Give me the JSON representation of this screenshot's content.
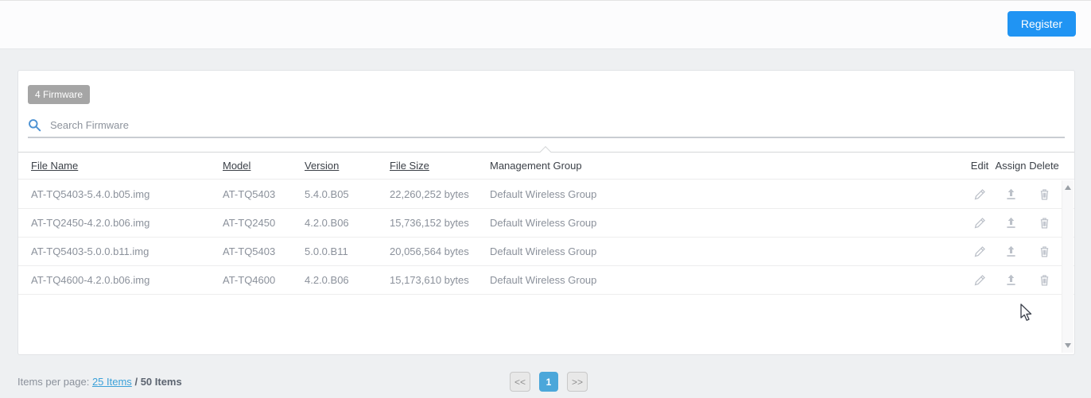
{
  "topbar": {
    "register_label": "Register"
  },
  "panel": {
    "badge_label": "4 Firmware",
    "search_placeholder": "Search Firmware",
    "search_value": ""
  },
  "table": {
    "headers": {
      "file_name": "File Name",
      "model": "Model",
      "version": "Version",
      "file_size": "File Size",
      "management_group": "Management Group",
      "edit": "Edit",
      "assign": "Assign",
      "delete": "Delete"
    },
    "rows": [
      {
        "file_name": "AT-TQ5403-5.4.0.b05.img",
        "model": "AT-TQ5403",
        "version": "5.4.0.B05",
        "file_size": "22,260,252 bytes",
        "management_group": "Default Wireless Group"
      },
      {
        "file_name": "AT-TQ2450-4.2.0.b06.img",
        "model": "AT-TQ2450",
        "version": "4.2.0.B06",
        "file_size": "15,736,152 bytes",
        "management_group": "Default Wireless Group"
      },
      {
        "file_name": "AT-TQ5403-5.0.0.b11.img",
        "model": "AT-TQ5403",
        "version": "5.0.0.B11",
        "file_size": "20,056,564 bytes",
        "management_group": "Default Wireless Group"
      },
      {
        "file_name": "AT-TQ4600-4.2.0.b06.img",
        "model": "AT-TQ4600",
        "version": "4.2.0.B06",
        "file_size": "15,173,610 bytes",
        "management_group": "Default Wireless Group"
      }
    ]
  },
  "footer": {
    "items_per_page_label": "Items per page:",
    "page_size_link": "25 Items",
    "separator": "/",
    "total_label": "50 Items",
    "pagination": {
      "prev": "<<",
      "current": "1",
      "next": ">>"
    }
  },
  "icons": {
    "search": "search-icon",
    "edit": "pencil-icon",
    "assign": "upload-icon",
    "delete": "trash-icon"
  },
  "colors": {
    "register_blue": "#2094f3",
    "pagination_blue": "#4ba7da",
    "link_blue": "#3ba1d9",
    "badge_gray": "#a5a5a5",
    "row_text_gray": "#8b919b",
    "page_background": "#eef0f2"
  }
}
